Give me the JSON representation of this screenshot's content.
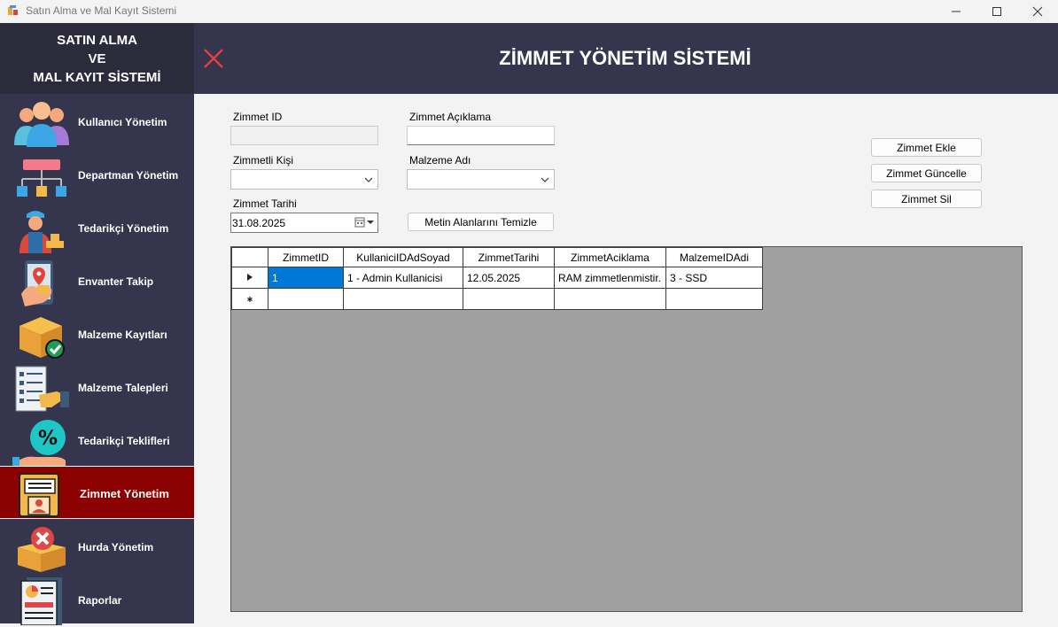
{
  "window": {
    "title": "Satın Alma ve Mal Kayıt Sistemi"
  },
  "sidebar": {
    "header_lines": [
      "SATIN ALMA",
      "VE",
      "MAL KAYIT SİSTEMİ"
    ],
    "items": [
      {
        "label": "Kullanıcı Yönetim",
        "icon": "users-icon"
      },
      {
        "label": "Departman Yönetim",
        "icon": "org-chart-icon"
      },
      {
        "label": "Tedarikçi Yönetim",
        "icon": "supplier-icon"
      },
      {
        "label": "Envanter Takip",
        "icon": "location-map-icon"
      },
      {
        "label": "Malzeme Kayıtları",
        "icon": "box-check-icon"
      },
      {
        "label": "Malzeme Talepleri",
        "icon": "checklist-icon"
      },
      {
        "label": "Tedarikçi Teklifleri",
        "icon": "discount-hand-icon"
      },
      {
        "label": "Zimmet Yönetim",
        "icon": "folder-profile-icon",
        "active": true
      },
      {
        "label": "Hurda Yönetim",
        "icon": "box-reject-icon"
      },
      {
        "label": "Raporlar",
        "icon": "report-chart-icon"
      }
    ]
  },
  "header": {
    "title": "ZİMMET YÖNETİM SİSTEMİ"
  },
  "form": {
    "zimmet_id_label": "Zimmet ID",
    "zimmet_id_value": "",
    "aciklama_label": "Zimmet Açıklama",
    "aciklama_value": "",
    "kisi_label": "Zimmetli Kişi",
    "kisi_value": "",
    "malzeme_label": "Malzeme Adı",
    "malzeme_value": "",
    "tarih_label": "Zimmet Tarihi",
    "tarih_value": "31.08.2025",
    "clear_button": "Metin Alanlarını Temizle"
  },
  "actions": {
    "add": "Zimmet Ekle",
    "update": "Zimmet Güncelle",
    "delete": "Zimmet Sil"
  },
  "grid": {
    "columns": [
      "ZimmetID",
      "KullaniciIDAdSoyad",
      "ZimmetTarihi",
      "ZimmetAciklama",
      "MalzemeIDAdi"
    ],
    "rows": [
      [
        "1",
        "1 - Admin Kullanicisi",
        "12.05.2025",
        "RAM zimmetlenmistir.",
        "3 - SSD"
      ]
    ]
  },
  "colors": {
    "sidebar_bg": "#35354d",
    "header_bg": "#2b2b3c",
    "active_item": "#8b0000",
    "close_x": "#e04040",
    "grid_bg": "#a0a0a0",
    "selection": "#0078d7"
  }
}
